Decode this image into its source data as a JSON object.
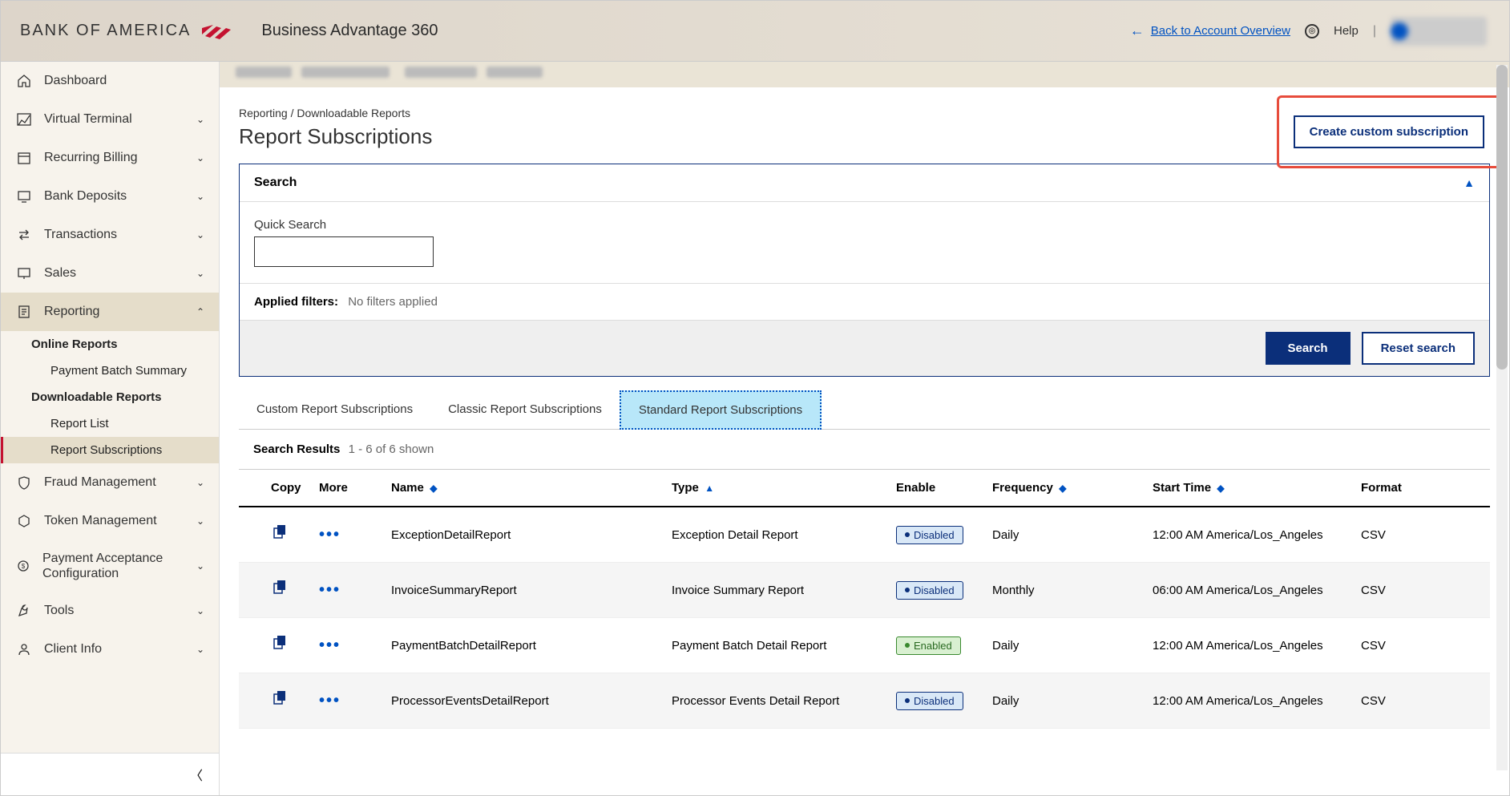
{
  "header": {
    "brand": "BANK OF AMERICA",
    "product": "Business Advantage 360",
    "back_link": "Back to Account Overview",
    "help": "Help"
  },
  "sidebar": {
    "items": [
      {
        "label": "Dashboard",
        "icon": "home"
      },
      {
        "label": "Virtual Terminal",
        "icon": "chart",
        "chevron": true
      },
      {
        "label": "Recurring Billing",
        "icon": "calendar",
        "chevron": true
      },
      {
        "label": "Bank Deposits",
        "icon": "monitor",
        "chevron": true
      },
      {
        "label": "Transactions",
        "icon": "swap",
        "chevron": true
      },
      {
        "label": "Sales",
        "icon": "screen",
        "chevron": true
      },
      {
        "label": "Reporting",
        "icon": "doc",
        "chevron_up": true,
        "active": true
      },
      {
        "label": "Fraud Management",
        "icon": "shield",
        "chevron": true
      },
      {
        "label": "Token Management",
        "icon": "hex",
        "chevron": true
      },
      {
        "label": "Payment Acceptance Configuration",
        "icon": "cog",
        "chevron": true
      },
      {
        "label": "Tools",
        "icon": "wrench",
        "chevron": true
      },
      {
        "label": "Client Info",
        "icon": "user",
        "chevron": true
      }
    ],
    "reporting_sub": {
      "online": "Online Reports",
      "payment_batch": "Payment Batch Summary",
      "downloadable": "Downloadable Reports",
      "report_list": "Report List",
      "report_subs": "Report Subscriptions"
    }
  },
  "breadcrumb": {
    "parent": "Reporting",
    "child": "Downloadable Reports"
  },
  "page": {
    "title": "Report Subscriptions"
  },
  "create_btn": "Create custom subscription",
  "search": {
    "title": "Search",
    "quick_label": "Quick Search",
    "applied_label": "Applied filters:",
    "applied_value": "No filters applied",
    "search_btn": "Search",
    "reset_btn": "Reset search"
  },
  "tabs": [
    {
      "label": "Custom Report Subscriptions"
    },
    {
      "label": "Classic Report Subscriptions"
    },
    {
      "label": "Standard Report Subscriptions",
      "active": true
    }
  ],
  "results": {
    "title": "Search Results",
    "count": "1 - 6 of 6 shown",
    "columns": [
      "Copy",
      "More",
      "Name",
      "Type",
      "Enable",
      "Frequency",
      "Start Time",
      "Format"
    ],
    "rows": [
      {
        "name": "ExceptionDetailReport",
        "type": "Exception Detail Report",
        "enable": "Disabled",
        "frequency": "Daily",
        "start": "12:00 AM America/Los_Angeles",
        "format": "CSV"
      },
      {
        "name": "InvoiceSummaryReport",
        "type": "Invoice Summary Report",
        "enable": "Disabled",
        "frequency": "Monthly",
        "start": "06:00 AM America/Los_Angeles",
        "format": "CSV"
      },
      {
        "name": "PaymentBatchDetailReport",
        "type": "Payment Batch Detail Report",
        "enable": "Enabled",
        "frequency": "Daily",
        "start": "12:00 AM America/Los_Angeles",
        "format": "CSV"
      },
      {
        "name": "ProcessorEventsDetailReport",
        "type": "Processor Events Detail Report",
        "enable": "Disabled",
        "frequency": "Daily",
        "start": "12:00 AM America/Los_Angeles",
        "format": "CSV"
      }
    ]
  }
}
